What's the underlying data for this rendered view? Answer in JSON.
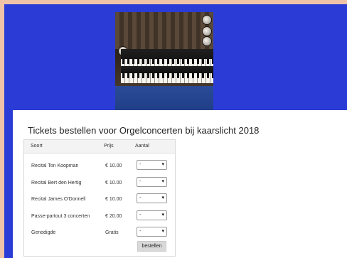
{
  "header": {
    "image_alt": "organ manuals"
  },
  "page": {
    "title": "Tickets bestellen voor Orgelconcerten bij kaarslicht 2018"
  },
  "table": {
    "headers": [
      "Soort",
      "Prijs",
      "Aantal"
    ],
    "rows": [
      {
        "soort": "Recital Ton Koopman",
        "prijs": "€ 10.00",
        "aantal": "-"
      },
      {
        "soort": "Recital Bert den Hertig",
        "prijs": "€ 10.00",
        "aantal": "-"
      },
      {
        "soort": "Recital James O'Donnell",
        "prijs": "€ 10.00",
        "aantal": "-"
      },
      {
        "soort": "Passe-partout 3 concerten",
        "prijs": "€ 20.00",
        "aantal": "-"
      },
      {
        "soort": "Genodigde",
        "prijs": "Gratis",
        "aantal": "-"
      }
    ],
    "submit_label": "bestellen"
  },
  "colors": {
    "background_outer": "#efc3a8",
    "background_blue": "#2a3bd6",
    "panel": "#ffffff"
  },
  "icons": {
    "select_arrow": "caret-down-icon"
  }
}
